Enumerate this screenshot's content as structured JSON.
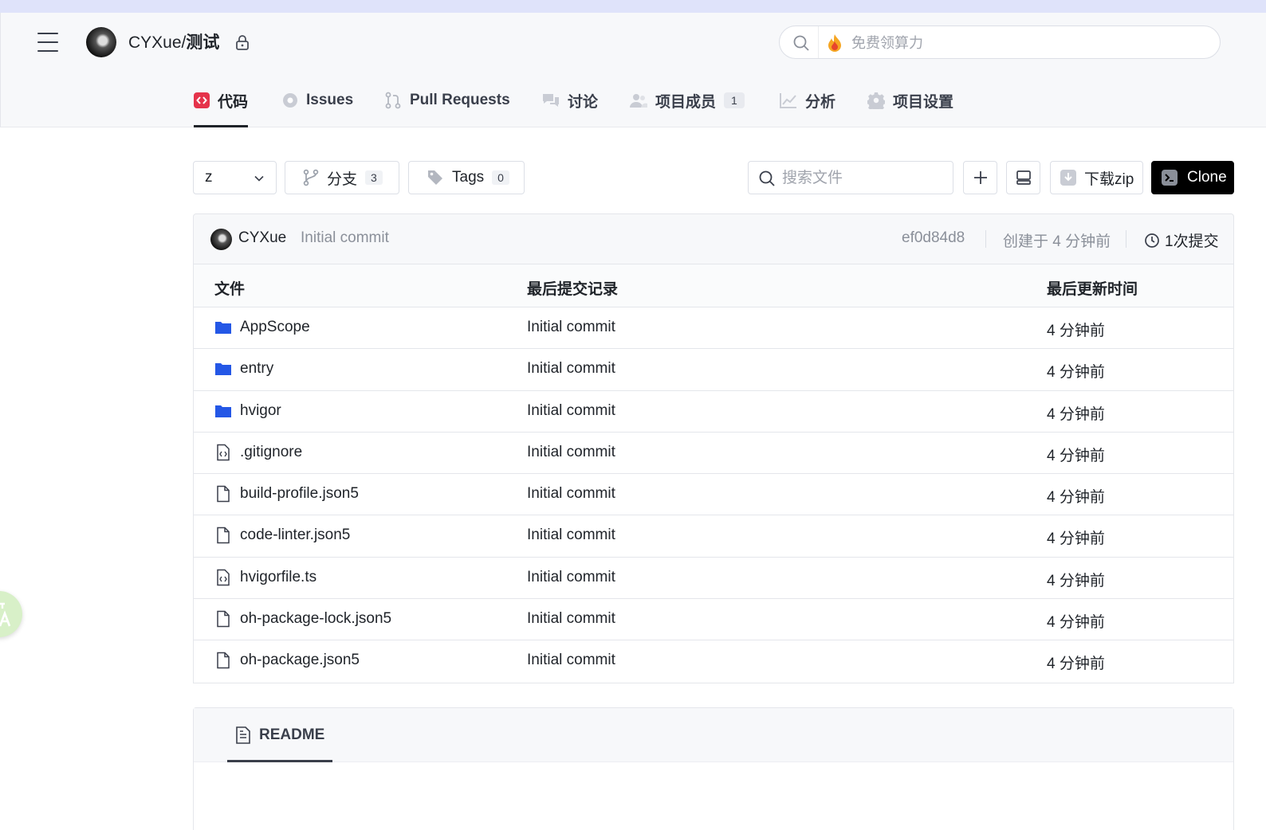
{
  "header": {
    "owner": "CYXue/",
    "repo": "测试",
    "search_placeholder": "免费领算力"
  },
  "tabs": [
    {
      "label": "代码"
    },
    {
      "label": "Issues"
    },
    {
      "label": "Pull Requests"
    },
    {
      "label": "讨论"
    },
    {
      "label": "项目成员",
      "count": "1"
    },
    {
      "label": "分析"
    },
    {
      "label": "项目设置"
    }
  ],
  "toolbar": {
    "branch_value": "z",
    "branches_label": "分支",
    "branches_count": "3",
    "tags_label": "Tags",
    "tags_count": "0",
    "file_search_placeholder": "搜索文件",
    "zip_label": "下载zip",
    "clone_label": "Clone"
  },
  "last_commit": {
    "author": "CYXue",
    "message": "Initial commit",
    "sha": "ef0d84d8",
    "created": "创建于 4 分钟前",
    "commits": "1次提交"
  },
  "table": {
    "headers": [
      "文件",
      "最后提交记录",
      "最后更新时间"
    ],
    "rows": [
      {
        "name": "AppScope",
        "type": "folder",
        "commit": "Initial commit",
        "time": "4 分钟前"
      },
      {
        "name": "entry",
        "type": "folder",
        "commit": "Initial commit",
        "time": "4 分钟前"
      },
      {
        "name": "hvigor",
        "type": "folder",
        "commit": "Initial commit",
        "time": "4 分钟前"
      },
      {
        "name": ".gitignore",
        "type": "code",
        "commit": "Initial commit",
        "time": "4 分钟前"
      },
      {
        "name": "build-profile.json5",
        "type": "file",
        "commit": "Initial commit",
        "time": "4 分钟前"
      },
      {
        "name": "code-linter.json5",
        "type": "file",
        "commit": "Initial commit",
        "time": "4 分钟前"
      },
      {
        "name": "hvigorfile.ts",
        "type": "code",
        "commit": "Initial commit",
        "time": "4 分钟前"
      },
      {
        "name": "oh-package-lock.json5",
        "type": "file",
        "commit": "Initial commit",
        "time": "4 分钟前"
      },
      {
        "name": "oh-package.json5",
        "type": "file",
        "commit": "Initial commit",
        "time": "4 分钟前"
      }
    ]
  },
  "readme": {
    "tab_label": "README"
  },
  "colors": {
    "folder": "#2457e6",
    "code_tab_icon": "#e5334b",
    "clone_bg": "#000000"
  }
}
